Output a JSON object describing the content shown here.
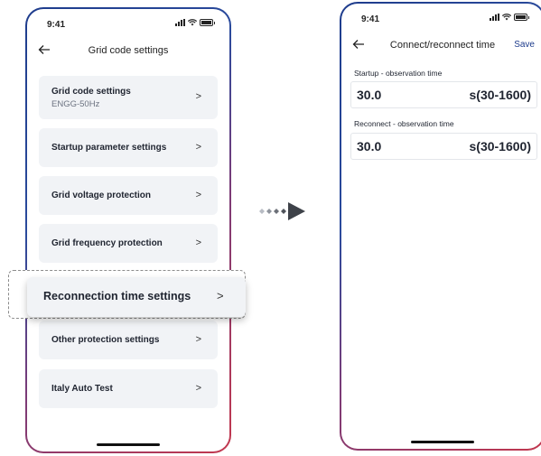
{
  "left_screen": {
    "status_time": "9:41",
    "nav_title": "Grid code settings",
    "menu_items": [
      {
        "label": "Grid code settings",
        "sub": "ENGG-50Hz"
      },
      {
        "label": "Startup parameter settings"
      },
      {
        "label": "Grid voltage protection"
      },
      {
        "label": "Grid frequency protection"
      },
      {
        "label": "Other protection settings"
      },
      {
        "label": "Italy Auto Test"
      }
    ],
    "highlighted_item": "Reconnection time settings"
  },
  "right_screen": {
    "status_time": "9:41",
    "nav_title": "Connect/reconnect time",
    "save_label": "Save",
    "fields": [
      {
        "label": "Startup - observation time",
        "value": "30.0",
        "unit": "s(30-1600)"
      },
      {
        "label": "Reconnect - observation time",
        "value": "30.0",
        "unit": "s(30-1600)"
      }
    ]
  },
  "icons": [
    "back-arrow-icon",
    "chevron-right-icon",
    "signal-icon",
    "wifi-icon",
    "battery-icon",
    "transition-arrow-icon"
  ],
  "colors": {
    "accent": "#1e3c8c",
    "frame_red": "#c3384e",
    "card_bg": "#f1f3f6"
  }
}
